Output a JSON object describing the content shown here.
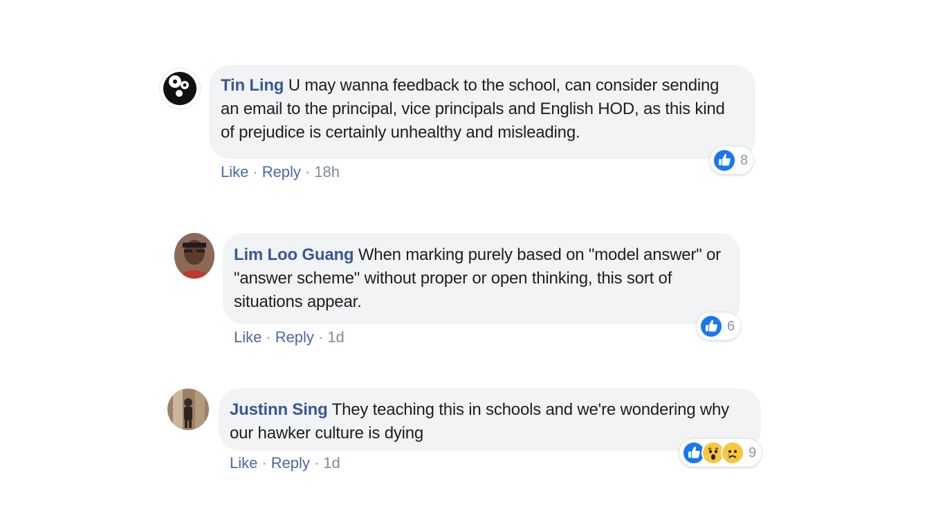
{
  "comments": [
    {
      "author": "Tin Ling",
      "text": "U may wanna feedback to the school, can consider sending an email to the principal, vice principals and English HOD, as this kind of prejudice is certainly unhealthy and misleading.",
      "like_label": "Like",
      "reply_label": "Reply",
      "time": "18h",
      "reaction_count": "8",
      "reactions": [
        "like-icon"
      ],
      "avatar": "panda-avatar"
    },
    {
      "author": "Lim Loo Guang",
      "text": "When marking purely based on \"model answer\" or \"answer scheme\" without proper or open thinking, this sort of situations appear.",
      "like_label": "Like",
      "reply_label": "Reply",
      "time": "1d",
      "reaction_count": "6",
      "reactions": [
        "like-icon"
      ],
      "avatar": "profile-photo-avatar"
    },
    {
      "author": "Justinn Sing",
      "text": "They teaching this in schools and we're wondering why our hawker culture is dying",
      "like_label": "Like",
      "reply_label": "Reply",
      "time": "1d",
      "reaction_count": "9",
      "reactions": [
        "like-icon",
        "wow-icon",
        "sad-icon"
      ],
      "avatar": "profile-photo-avatar"
    }
  ],
  "colors": {
    "author": "#385898",
    "bubble": "#f2f3f5",
    "like": "#1877f2",
    "emoji": "#f7c73c"
  }
}
